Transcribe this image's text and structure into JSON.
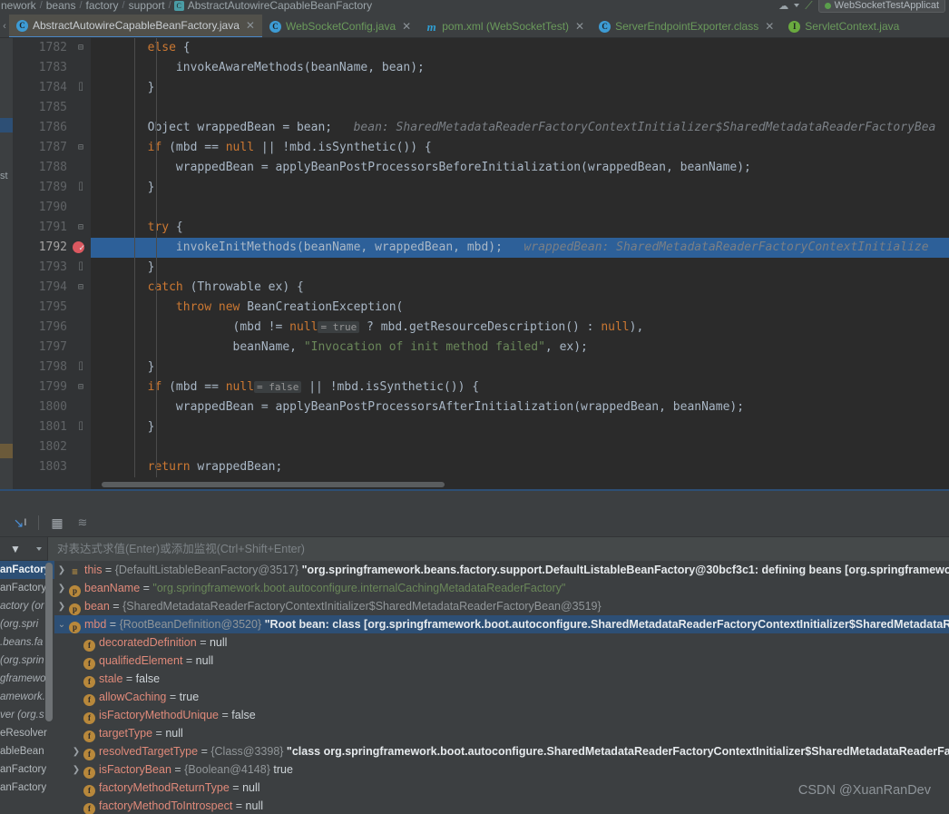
{
  "breadcrumb": {
    "segments": [
      "nework",
      "beans",
      "factory",
      "support"
    ],
    "current": "AbstractAutowireCapableBeanFactory",
    "run_config": "WebSocketTestApplicat"
  },
  "tabs": [
    {
      "label": "AbstractAutowireCapableBeanFactory.java",
      "icon": "java-class-icon",
      "icon_letter": "C",
      "active": true,
      "closable": true
    },
    {
      "label": "WebSocketConfig.java",
      "icon": "java-class-icon",
      "icon_letter": "C",
      "active": false,
      "closable": true
    },
    {
      "label": "pom.xml (WebSocketTest)",
      "icon": "maven-icon",
      "icon_letter": "m",
      "active": false,
      "closable": true
    },
    {
      "label": "ServerEndpointExporter.class",
      "icon": "java-class-icon",
      "icon_letter": "C",
      "active": false,
      "closable": true
    },
    {
      "label": "ServletContext.java",
      "icon": "java-interface-icon",
      "icon_letter": "I",
      "active": false,
      "closable": false
    }
  ],
  "editor": {
    "lines": [
      {
        "num": "1782",
        "fold": "collapse",
        "html": "        <span class=\"kw\">else</span> {"
      },
      {
        "num": "1783",
        "fold": "",
        "html": "            invokeAwareMethods(beanName, bean);"
      },
      {
        "num": "1784",
        "fold": "end",
        "html": "        }"
      },
      {
        "num": "1785",
        "fold": "",
        "html": ""
      },
      {
        "num": "1786",
        "fold": "",
        "html": "        Object wrappedBean = bean;   <span class=\"hint\">bean: SharedMetadataReaderFactoryContextInitializer$SharedMetadataReaderFactoryBea</span>"
      },
      {
        "num": "1787",
        "fold": "collapse",
        "html": "        <span class=\"kw\">if</span> (mbd == <span class=\"kw\">null</span> || !mbd.isSynthetic()) {"
      },
      {
        "num": "1788",
        "fold": "",
        "html": "            wrappedBean = applyBeanPostProcessorsBeforeInitialization(wrappedBean, beanName);"
      },
      {
        "num": "1789",
        "fold": "end",
        "html": "        }"
      },
      {
        "num": "1790",
        "fold": "",
        "html": ""
      },
      {
        "num": "1791",
        "fold": "collapse",
        "html": "        <span class=\"kw\">try</span> {"
      },
      {
        "num": "1792",
        "fold": "",
        "breakpoint": true,
        "highlight": true,
        "html": "            invokeInitMethods(beanName, wrappedBean, mbd);   <span class=\"hint\">wrappedBean: SharedMetadataReaderFactoryContextInitialize</span>"
      },
      {
        "num": "1793",
        "fold": "end",
        "html": "        }"
      },
      {
        "num": "1794",
        "fold": "collapse",
        "html": "        <span class=\"kw\">catch</span> (Throwable ex) {"
      },
      {
        "num": "1795",
        "fold": "",
        "html": "            <span class=\"kw\">throw new</span> BeanCreationException("
      },
      {
        "num": "1796",
        "fold": "",
        "html": "                    (mbd != <span class=\"kw\">null</span><span class=\"inline-val\">= true</span> ? mbd.getResourceDescription() : <span class=\"kw\">null</span>),"
      },
      {
        "num": "1797",
        "fold": "",
        "html": "                    beanName, <span class=\"str\">\"Invocation of init method failed\"</span>, ex);"
      },
      {
        "num": "1798",
        "fold": "end",
        "html": "        }"
      },
      {
        "num": "1799",
        "fold": "collapse",
        "html": "        <span class=\"kw\">if</span> (mbd == <span class=\"kw\">null</span><span class=\"inline-val\">= false</span> || !mbd.isSynthetic()) {"
      },
      {
        "num": "1800",
        "fold": "",
        "html": "            wrappedBean = applyBeanPostProcessorsAfterInitialization(wrappedBean, beanName);"
      },
      {
        "num": "1801",
        "fold": "end",
        "html": "        }"
      },
      {
        "num": "1802",
        "fold": "",
        "html": ""
      },
      {
        "num": "1803",
        "fold": "",
        "html": "        <span class=\"kw\">return</span> wrappedBean;"
      }
    ]
  },
  "debugger": {
    "toolbar": [
      {
        "name": "evaluate-expression-icon",
        "glyph": "↘"
      },
      {
        "name": "show-as-table-icon",
        "glyph": "▦"
      },
      {
        "name": "group-by-icon",
        "glyph": "≋"
      }
    ],
    "watch": {
      "filter_icon": "▼",
      "caret_icon": "▾",
      "placeholder": "对表达式求值(Enter)或添加监视(Ctrl+Shift+Enter)"
    },
    "frames": [
      {
        "text": "anFactory",
        "selected": true
      },
      {
        "text": "anFactory",
        "selected": false
      },
      {
        "text": "actory (or",
        "selected": false,
        "italic": true
      },
      {
        "text": "  (org.spri",
        "selected": false,
        "italic": true
      },
      {
        "text": ".beans.fa",
        "selected": false,
        "italic": true
      },
      {
        "text": "(org.sprin",
        "selected": false,
        "italic": true
      },
      {
        "text": "gframewo",
        "selected": false,
        "italic": true
      },
      {
        "text": "amework.",
        "selected": false,
        "italic": true
      },
      {
        "text": "ver (org.s",
        "selected": false,
        "italic": true
      },
      {
        "text": "eResolver",
        "selected": false
      },
      {
        "text": "ableBean",
        "selected": false
      },
      {
        "text": "anFactory",
        "selected": false
      },
      {
        "text": "anFactory",
        "selected": false
      }
    ],
    "variables": [
      {
        "chevron": "collapsed",
        "icon": "frame-icon",
        "icon_letter": "≡",
        "name": "this",
        "indent": 0,
        "selected": false,
        "value_parts": [
          {
            "t": " = ",
            "cls": "veq"
          },
          {
            "t": "{DefaultListableBeanFactory@3517}",
            "cls": "vref"
          },
          {
            "t": " \"org.springframework.beans.factory.support.DefaultListableBeanFactory@30bcf3c1: defining beans [org.springframewor",
            "cls": "vbold"
          }
        ]
      },
      {
        "chevron": "collapsed",
        "icon": "parameter-icon",
        "icon_letter": "p",
        "name": "beanName",
        "indent": 0,
        "selected": false,
        "value_parts": [
          {
            "t": " = ",
            "cls": "veq"
          },
          {
            "t": "\"org.springframework.boot.autoconfigure.internalCachingMetadataReaderFactory\"",
            "cls": "vstr"
          }
        ]
      },
      {
        "chevron": "collapsed",
        "icon": "parameter-icon",
        "icon_letter": "p",
        "name": "bean",
        "indent": 0,
        "selected": false,
        "value_parts": [
          {
            "t": " = ",
            "cls": "veq"
          },
          {
            "t": "{SharedMetadataReaderFactoryContextInitializer$SharedMetadataReaderFactoryBean@3519}",
            "cls": "vref"
          }
        ]
      },
      {
        "chevron": "expanded",
        "icon": "parameter-icon",
        "icon_letter": "p",
        "name": "mbd",
        "indent": 0,
        "selected": true,
        "value_parts": [
          {
            "t": " = ",
            "cls": "veq"
          },
          {
            "t": "{RootBeanDefinition@3520}",
            "cls": "vref"
          },
          {
            "t": " \"Root bean: class [org.springframework.boot.autoconfigure.SharedMetadataReaderFactoryContextInitializer$SharedMetadataR",
            "cls": "vbold"
          }
        ]
      },
      {
        "chevron": "none",
        "icon": "field-icon",
        "icon_letter": "f",
        "name": "decoratedDefinition",
        "indent": 1,
        "selected": false,
        "value_parts": [
          {
            "t": " = ",
            "cls": "veq"
          },
          {
            "t": "null",
            "cls": "vlit"
          }
        ]
      },
      {
        "chevron": "none",
        "icon": "field-icon",
        "icon_letter": "f",
        "name": "qualifiedElement",
        "indent": 1,
        "selected": false,
        "value_parts": [
          {
            "t": " = ",
            "cls": "veq"
          },
          {
            "t": "null",
            "cls": "vlit"
          }
        ]
      },
      {
        "chevron": "none",
        "icon": "field-icon",
        "icon_letter": "f",
        "name": "stale",
        "indent": 1,
        "selected": false,
        "value_parts": [
          {
            "t": " = ",
            "cls": "veq"
          },
          {
            "t": "false",
            "cls": "vlit"
          }
        ]
      },
      {
        "chevron": "none",
        "icon": "field-icon",
        "icon_letter": "f",
        "name": "allowCaching",
        "indent": 1,
        "selected": false,
        "value_parts": [
          {
            "t": " = ",
            "cls": "veq"
          },
          {
            "t": "true",
            "cls": "vlit"
          }
        ]
      },
      {
        "chevron": "none",
        "icon": "field-icon",
        "icon_letter": "f",
        "name": "isFactoryMethodUnique",
        "indent": 1,
        "selected": false,
        "value_parts": [
          {
            "t": " = ",
            "cls": "veq"
          },
          {
            "t": "false",
            "cls": "vlit"
          }
        ]
      },
      {
        "chevron": "none",
        "icon": "field-icon",
        "icon_letter": "f",
        "name": "targetType",
        "indent": 1,
        "selected": false,
        "value_parts": [
          {
            "t": " = ",
            "cls": "veq"
          },
          {
            "t": "null",
            "cls": "vlit"
          }
        ]
      },
      {
        "chevron": "collapsed",
        "icon": "field-icon",
        "icon_letter": "f",
        "name": "resolvedTargetType",
        "indent": 1,
        "selected": false,
        "value_parts": [
          {
            "t": " = ",
            "cls": "veq"
          },
          {
            "t": "{Class@3398}",
            "cls": "vref"
          },
          {
            "t": " \"class org.springframework.boot.autoconfigure.SharedMetadataReaderFactoryContextInitializer$SharedMetadataReaderFa",
            "cls": "vbold"
          }
        ]
      },
      {
        "chevron": "collapsed",
        "icon": "field-icon",
        "icon_letter": "f",
        "name": "isFactoryBean",
        "indent": 1,
        "selected": false,
        "value_parts": [
          {
            "t": " = ",
            "cls": "veq"
          },
          {
            "t": "{Boolean@4148}",
            "cls": "vref"
          },
          {
            "t": " true",
            "cls": "vlit"
          }
        ]
      },
      {
        "chevron": "none",
        "icon": "field-icon",
        "icon_letter": "f",
        "name": "factoryMethodReturnType",
        "indent": 1,
        "selected": false,
        "value_parts": [
          {
            "t": " = ",
            "cls": "veq"
          },
          {
            "t": "null",
            "cls": "vlit"
          }
        ]
      },
      {
        "chevron": "none",
        "icon": "field-icon",
        "icon_letter": "f",
        "name": "factoryMethodToIntrospect",
        "indent": 1,
        "selected": false,
        "value_parts": [
          {
            "t": " = ",
            "cls": "veq"
          },
          {
            "t": "null",
            "cls": "vlit"
          }
        ]
      }
    ]
  },
  "watermark": "CSDN @XuanRanDev",
  "colors": {
    "editor_bg": "#2b2b2b",
    "panel_bg": "#3c3f41",
    "selection_blue": "#2d6099",
    "row_select_blue": "#2d4f75",
    "keyword_orange": "#cc7832",
    "string_green": "#6a8759",
    "breakpoint_red": "#db5860",
    "tab_green": "#6a9a5b"
  }
}
